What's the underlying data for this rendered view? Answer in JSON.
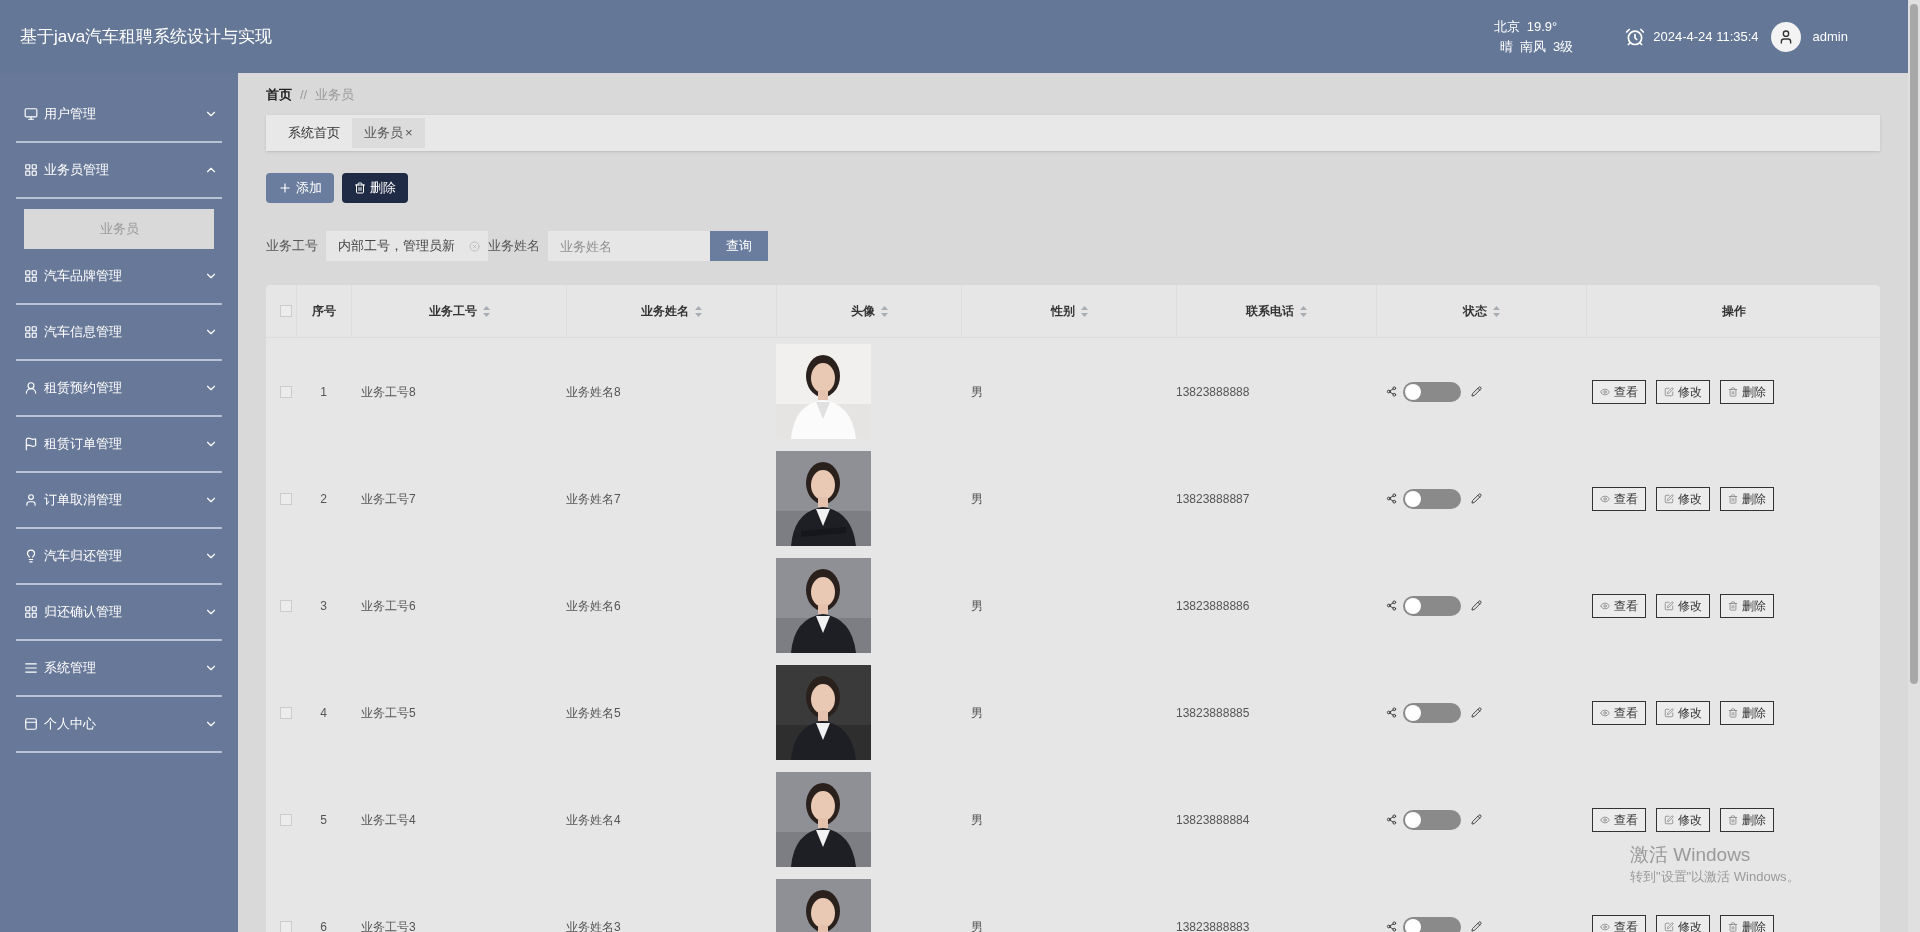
{
  "header": {
    "title": "基于java汽车租聘系统设计与实现",
    "weather_city": "北京  19.9°",
    "weather_desc": "晴  南风  3级",
    "datetime": "2024-4-24 11:35:4",
    "user": "admin"
  },
  "sidebar": {
    "items": [
      {
        "label": "用户管理",
        "expanded": false
      },
      {
        "label": "业务员管理",
        "expanded": true,
        "children": [
          {
            "label": "业务员",
            "selected": true
          }
        ]
      },
      {
        "label": "汽车品牌管理",
        "expanded": false
      },
      {
        "label": "汽车信息管理",
        "expanded": false
      },
      {
        "label": "租赁预约管理",
        "expanded": false
      },
      {
        "label": "租赁订单管理",
        "expanded": false
      },
      {
        "label": "订单取消管理",
        "expanded": false
      },
      {
        "label": "汽车归还管理",
        "expanded": false
      },
      {
        "label": "归还确认管理",
        "expanded": false
      },
      {
        "label": "系统管理",
        "expanded": false
      },
      {
        "label": "个人中心",
        "expanded": false
      }
    ]
  },
  "breadcrumb": [
    "首页",
    "//",
    "业务员"
  ],
  "tabs": [
    {
      "label": "系统首页",
      "selected": false
    },
    {
      "label": "业务员",
      "selected": true,
      "close": "×"
    }
  ],
  "actions": [
    "添加",
    "删除"
  ],
  "search": {
    "fields": [
      {
        "label": "业务工号",
        "value": "内部工号，管理员新"
      },
      {
        "label": "业务姓名",
        "placeholder": "业务姓名"
      }
    ],
    "button": "查询"
  },
  "table": {
    "all_checked": false,
    "columns": [
      "序号",
      "业务工号",
      "业务姓名",
      "头像",
      "性别",
      "联系电话",
      "状态",
      "操作"
    ],
    "rows": [
      {
        "checked": false,
        "index": "1",
        "code": "业务工号8",
        "name": "业务姓名8",
        "gender": "男",
        "phone": "13823888888",
        "on": false,
        "actions": [
          "查看",
          "修改",
          "删除"
        ]
      },
      {
        "checked": false,
        "index": "2",
        "code": "业务工号7",
        "name": "业务姓名7",
        "gender": "男",
        "phone": "13823888887",
        "on": false,
        "actions": [
          "查看",
          "修改",
          "删除"
        ]
      },
      {
        "checked": false,
        "index": "3",
        "code": "业务工号6",
        "name": "业务姓名6",
        "gender": "男",
        "phone": "13823888886",
        "on": false,
        "actions": [
          "查看",
          "修改",
          "删除"
        ]
      },
      {
        "checked": false,
        "index": "4",
        "code": "业务工号5",
        "name": "业务姓名5",
        "gender": "男",
        "phone": "13823888885",
        "on": false,
        "actions": [
          "查看",
          "修改",
          "删除"
        ]
      },
      {
        "checked": false,
        "index": "5",
        "code": "业务工号4",
        "name": "业务姓名4",
        "gender": "男",
        "phone": "13823888884",
        "on": false,
        "actions": [
          "查看",
          "修改",
          "删除"
        ]
      },
      {
        "checked": false,
        "index": "6",
        "code": "业务工号3",
        "name": "业务姓名3",
        "gender": "男",
        "phone": "13823888883",
        "on": false,
        "actions": [
          "查看",
          "修改",
          "删除"
        ]
      }
    ]
  },
  "os_notice": {
    "title": "激活 Windows",
    "text": "转到\"设置\"以激活 Windows。"
  }
}
